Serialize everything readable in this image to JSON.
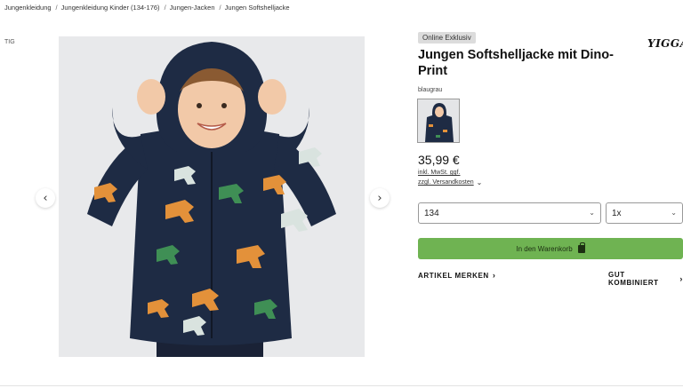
{
  "breadcrumb": [
    {
      "label": "Jungenkleidung"
    },
    {
      "label": "Jungenkleidung Kinder (134-176)"
    },
    {
      "label": "Jungen-Jacken"
    },
    {
      "label": "Jungen Softshelljacke"
    }
  ],
  "side_label": "TIG",
  "badge": "Online Exklusiv",
  "brand": "YIGGA",
  "product": {
    "title": "Jungen Softshelljacke mit Dino-Print",
    "color": "blaugrau",
    "price": "35,99 €",
    "tax_link": "inkl. MwSt. ggf.",
    "shipping_link": "zzgl. Versandkosten"
  },
  "size_select": {
    "value": "134"
  },
  "qty_select": {
    "value": "1x"
  },
  "cart_button": {
    "label": "In den Warenkorb"
  },
  "actions": {
    "remember": "ARTIKEL MERKEN",
    "combined": "GUT KOMBINIERT"
  },
  "icons": {
    "prev": "chevron-left-icon",
    "next": "chevron-right-icon",
    "bag": "shopping-bag-icon"
  },
  "colors": {
    "accent": "#6fb352",
    "jacket": "#1e2b44",
    "dino_orange": "#e3913a",
    "dino_green": "#3f8f55",
    "dino_white": "#d9e3df"
  }
}
